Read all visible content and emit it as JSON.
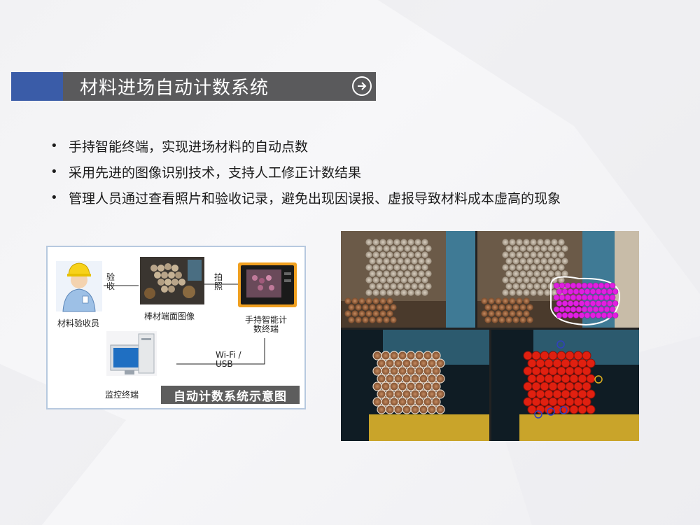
{
  "title": {
    "text": "材料进场自动计数系统",
    "arrow_icon": "circle-arrow-right-icon"
  },
  "bullets": [
    "手持智能终端，实现进场材料的自动点数",
    "采用先进的图像识别技术，支持人工修正计数结果",
    "管理人员通过查看照片和验收记录，避免出现因误报、虚报导致材料成本虚高的现象"
  ],
  "bullet_symbol": "•",
  "diagram": {
    "inspector_label": "材料验收员",
    "inspect_action": "验收",
    "rebar_label": "棒材端面图像",
    "photo_action": "拍照",
    "terminal_label": "手持智能计数终端",
    "link_label": "Wi-Fi / USB",
    "monitor_label": "监控终端",
    "caption": "自动计数系统示意图"
  },
  "colors": {
    "accent": "#3a5ca8",
    "title_bg": "#5a5a5c",
    "diagram_border": "#b7c9df",
    "detect_magenta": "#e020e0",
    "detect_red": "#e02010"
  }
}
